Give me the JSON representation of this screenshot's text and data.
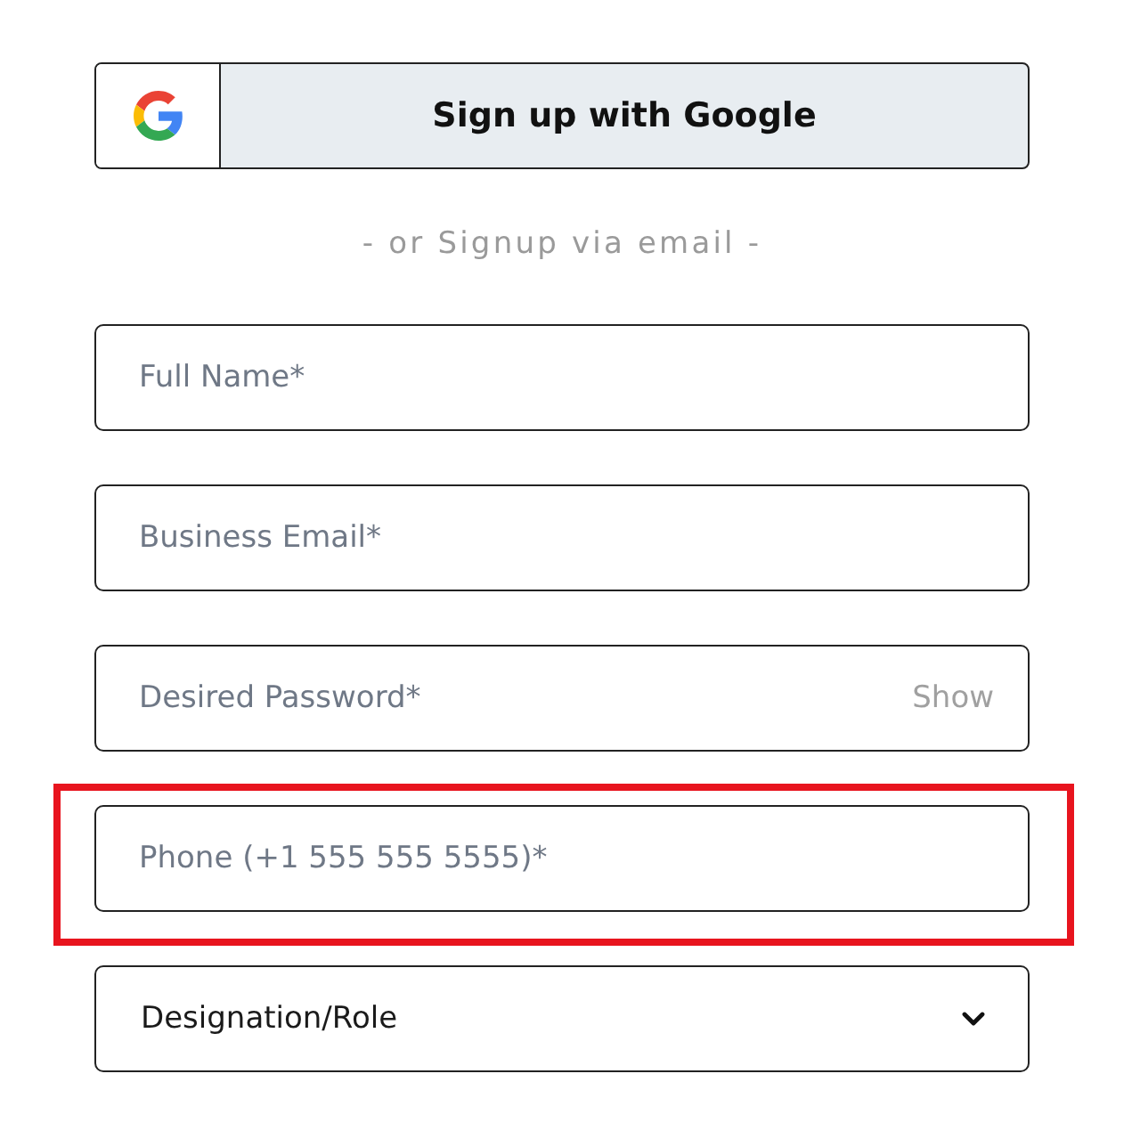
{
  "google_button": {
    "label": "Sign up with Google"
  },
  "divider_text": "- or Signup via email -",
  "fields": [
    {
      "kind": "text",
      "placeholder": "Full Name*",
      "highlighted": false
    },
    {
      "kind": "email",
      "placeholder": "Business Email*",
      "highlighted": false
    },
    {
      "kind": "password",
      "placeholder": "Desired Password*",
      "toggle_label": "Show",
      "highlighted": false
    },
    {
      "kind": "phone",
      "placeholder": "Phone (+1 555 555 5555)*",
      "highlighted": true
    },
    {
      "kind": "select",
      "value": "Designation/Role",
      "highlighted": false
    }
  ]
}
